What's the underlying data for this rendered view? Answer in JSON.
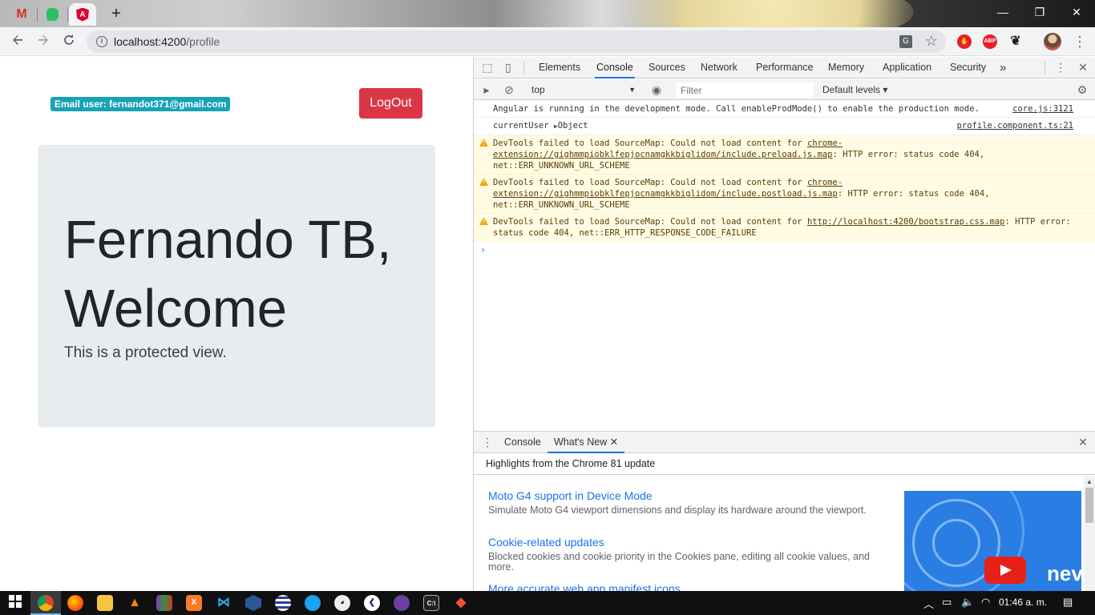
{
  "browser": {
    "tabs": [
      {
        "name": "gmail",
        "glyph": "M"
      },
      {
        "name": "evernote",
        "glyph": ""
      },
      {
        "name": "angular",
        "glyph": "A"
      }
    ],
    "new_tab": "+",
    "url_host": "localhost:4200",
    "url_path": "/profile",
    "ext_abp": "ABP",
    "window_controls": {
      "minimize": "—",
      "restore": "❐",
      "close": "✕"
    }
  },
  "page": {
    "email_badge": "Email user: fernandot371@gmail.com",
    "logout_label": "LogOut",
    "heading": "Fernando TB, Welcome",
    "lead": "This is a protected view."
  },
  "devtools": {
    "tabs": [
      "Elements",
      "Console",
      "Sources",
      "Network",
      "Performance",
      "Memory",
      "Application",
      "Security"
    ],
    "more_tabs": "»",
    "context": "top",
    "filter_placeholder": "Filter",
    "levels": "Default levels ▾",
    "messages": {
      "angular": {
        "text": "Angular is running in the development mode. Call enableProdMode() to enable the production mode.",
        "src": "core.js:3121"
      },
      "current_user": {
        "label": "currentUser",
        "value": "Object",
        "src": "profile.component.ts:21"
      },
      "warn1": {
        "pre": "DevTools failed to load SourceMap: Could not load content for ",
        "link": "chrome-extension://gighmmpiobklfepjocnamgkkbiglidom/include.preload.js.map",
        "post": ": HTTP error: status code 404, net::ERR_UNKNOWN_URL_SCHEME"
      },
      "warn2": {
        "pre": "DevTools failed to load SourceMap: Could not load content for ",
        "link": "chrome-extension://gighmmpiobklfepjocnamgkkbiglidom/include.postload.js.map",
        "post": ": HTTP error: status code 404, net::ERR_UNKNOWN_URL_SCHEME"
      },
      "warn3": {
        "pre": "DevTools failed to load SourceMap: Could not load content for ",
        "link": "http://localhost:4200/bootstrap.css.map",
        "post": ": HTTP error: status code 404, net::ERR_HTTP_RESPONSE_CODE_FAILURE"
      }
    },
    "prompt": "›",
    "drawer": {
      "tabs": [
        "Console",
        "What's New"
      ],
      "close": "✕",
      "header": "Highlights from the Chrome 81 update",
      "items": [
        {
          "title": "Moto G4 support in Device Mode",
          "desc": "Simulate Moto G4 viewport dimensions and display its hardware around the viewport."
        },
        {
          "title": "Cookie-related updates",
          "desc": "Blocked cookies and cookie priority in the Cookies pane, editing all cookie values, and more."
        },
        {
          "title": "More accurate web app manifest icons",
          "desc": ""
        }
      ],
      "thumb_text": "nev"
    }
  },
  "taskbar": {
    "time": "01:46 a. m.",
    "apps": [
      "chrome",
      "firefox",
      "file-explorer",
      "vlc",
      "winrar",
      "xampp",
      "vscode",
      "app-shield",
      "app-stripes",
      "app-bird",
      "app-palette",
      "app-arrow",
      "app-cat",
      "cmd",
      "git"
    ]
  },
  "colors": {
    "badge": "#17a2b8",
    "logout": "#dc3545",
    "jumbotron": "#e9ecef",
    "devtools_accent": "#1a73e8",
    "warning_bg": "#fffbe5"
  }
}
